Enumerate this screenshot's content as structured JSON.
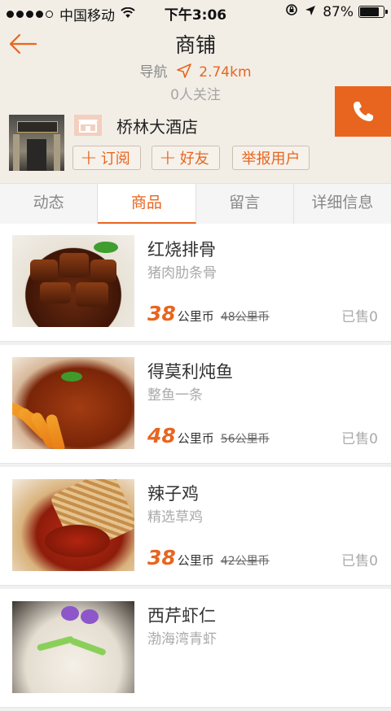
{
  "status_bar": {
    "carrier": "中国移动",
    "time": "下午3:06",
    "battery": "87%",
    "battery_level": 0.87
  },
  "header": {
    "title": "商铺",
    "nav_label": "导航",
    "distance": "2.74km",
    "followers": "0人关注",
    "shop_name": "桥林大酒店",
    "subscribe_label": "订阅",
    "friend_label": "好友",
    "report_label": "举报用户"
  },
  "tabs": [
    {
      "label": "动态",
      "active": false
    },
    {
      "label": "商品",
      "active": true
    },
    {
      "label": "留言",
      "active": false
    },
    {
      "label": "详细信息",
      "active": false
    }
  ],
  "products": [
    {
      "name": "红烧排骨",
      "desc": "猪肉肋条骨",
      "price": "38",
      "currency": "公里币",
      "old_price": "48公里币",
      "sold": "已售0"
    },
    {
      "name": "得莫利炖鱼",
      "desc": "整鱼一条",
      "price": "48",
      "currency": "公里币",
      "old_price": "56公里币",
      "sold": "已售0"
    },
    {
      "name": "辣子鸡",
      "desc": "精选草鸡",
      "price": "38",
      "currency": "公里币",
      "old_price": "42公里币",
      "sold": "已售0"
    },
    {
      "name": "西芹虾仁",
      "desc": "渤海湾青虾",
      "price": "",
      "currency": "",
      "old_price": "",
      "sold": ""
    }
  ],
  "colors": {
    "accent": "#e8651f",
    "header_bg": "#f2eee6"
  }
}
